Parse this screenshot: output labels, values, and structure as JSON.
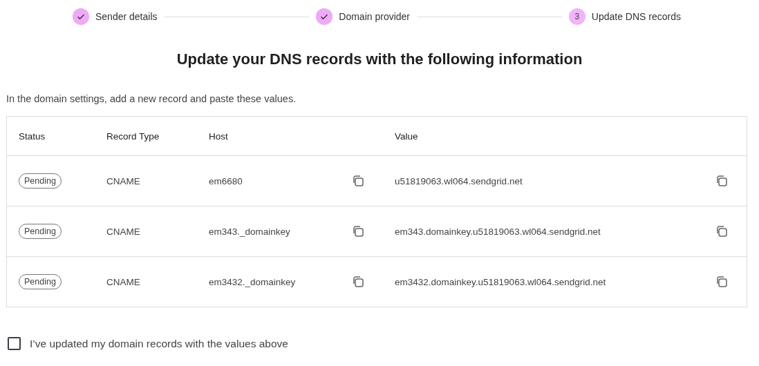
{
  "stepper": [
    {
      "label": "Sender details",
      "completed": true
    },
    {
      "label": "Domain provider",
      "completed": true
    },
    {
      "label": "Update DNS records",
      "completed": false,
      "number": "3"
    }
  ],
  "title": "Update your DNS records with the following information",
  "intro": "In the domain settings, add a new record and paste these values.",
  "table": {
    "columns": [
      "Status",
      "Record Type",
      "Host",
      "Value"
    ],
    "rows": [
      {
        "status": "Pending",
        "type": "CNAME",
        "host": "em6680",
        "value": "u51819063.wl064.sendgrid.net"
      },
      {
        "status": "Pending",
        "type": "CNAME",
        "host": "em343._domainkey",
        "value": "em343.domainkey.u51819063.wl064.sendgrid.net"
      },
      {
        "status": "Pending",
        "type": "CNAME",
        "host": "em3432._domainkey",
        "value": "em3432.domainkey.u51819063.wl064.sendgrid.net"
      }
    ]
  },
  "confirm": {
    "label": "I’ve updated my domain records with the values above",
    "checked": false
  }
}
